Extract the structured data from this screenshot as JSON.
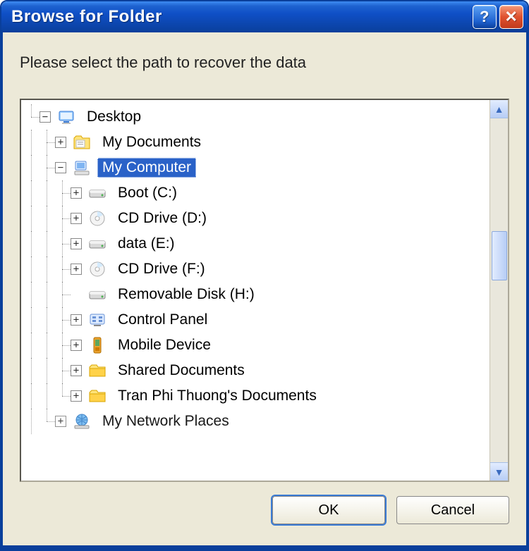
{
  "window": {
    "title": "Browse for Folder"
  },
  "instruction": "Please select the path to recover the data",
  "tree": {
    "root": {
      "label": "Desktop",
      "icon": "desktop-icon",
      "expander": "minus",
      "children": [
        {
          "label": "My Documents",
          "icon": "my-documents-icon",
          "expander": "plus"
        },
        {
          "label": "My Computer",
          "icon": "my-computer-icon",
          "expander": "minus",
          "selected": true,
          "children": [
            {
              "label": "Boot (C:)",
              "icon": "hdd-icon",
              "expander": "plus"
            },
            {
              "label": "CD Drive (D:)",
              "icon": "cd-icon",
              "expander": "plus"
            },
            {
              "label": "data (E:)",
              "icon": "hdd-icon",
              "expander": "plus"
            },
            {
              "label": "CD Drive (F:)",
              "icon": "cd-icon",
              "expander": "plus"
            },
            {
              "label": "Removable Disk (H:)",
              "icon": "hdd-icon",
              "expander": "none"
            },
            {
              "label": "Control Panel",
              "icon": "control-panel-icon",
              "expander": "plus"
            },
            {
              "label": "Mobile Device",
              "icon": "mobile-icon",
              "expander": "plus"
            },
            {
              "label": "Shared Documents",
              "icon": "folder-icon",
              "expander": "plus"
            },
            {
              "label": "Tran Phi Thuong's Documents",
              "icon": "folder-icon",
              "expander": "plus"
            }
          ]
        },
        {
          "label": "My Network Places",
          "icon": "network-icon",
          "expander": "plus",
          "partial": true
        }
      ]
    }
  },
  "buttons": {
    "ok": "OK",
    "cancel": "Cancel"
  },
  "colors": {
    "titlebar_start": "#3f8cf3",
    "titlebar_end": "#0a3f9b",
    "client_bg": "#ece9d8",
    "selection_bg": "#2a62c8"
  }
}
